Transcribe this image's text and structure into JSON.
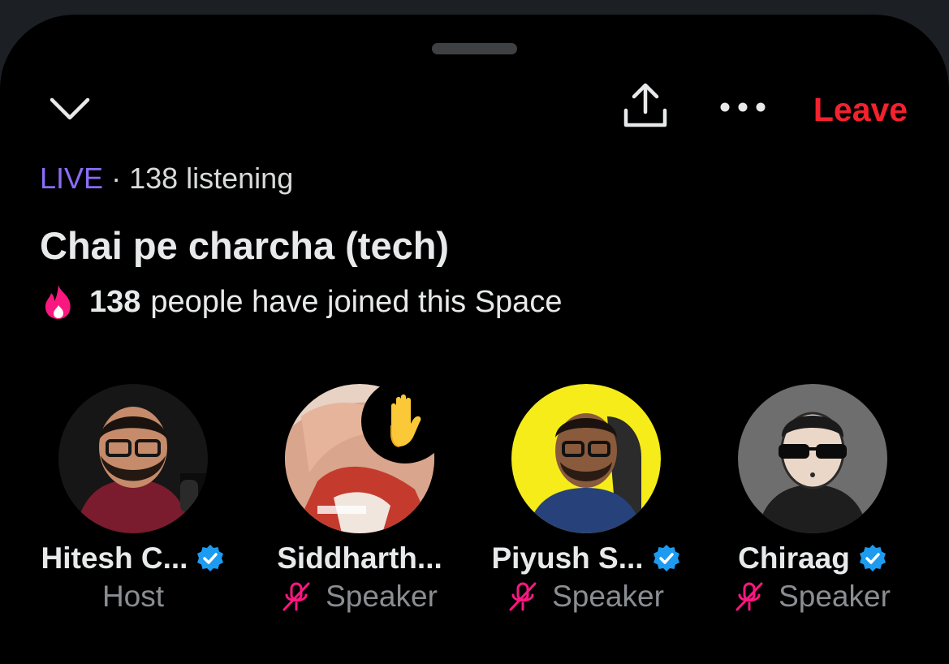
{
  "header": {
    "collapse_icon": "chevron-down-icon",
    "share_icon": "share-upload-icon",
    "more_icon": "more-dots-icon",
    "leave_label": "Leave"
  },
  "space": {
    "live_label": "LIVE",
    "separator": "·",
    "listening": "138 listening",
    "title": "Chai pe charcha (tech)",
    "joined_icon": "flame-icon",
    "joined_count": "138",
    "joined_text": "people have joined this Space"
  },
  "participants": [
    {
      "name": "Hitesh C...",
      "verified": true,
      "role": "Host",
      "muted": false,
      "hand_raised": false
    },
    {
      "name": "Siddharth...",
      "verified": false,
      "role": "Speaker",
      "muted": true,
      "hand_raised": true,
      "hand_icon": "raised-hand-icon"
    },
    {
      "name": "Piyush S...",
      "verified": true,
      "role": "Speaker",
      "muted": true,
      "hand_raised": false
    },
    {
      "name": "Chiraag",
      "verified": true,
      "role": "Speaker",
      "muted": true,
      "hand_raised": false
    }
  ],
  "colors": {
    "accent_live": "#8b6cf6",
    "leave": "#f4212e",
    "verified": "#1d9bf0",
    "muted_mic": "#f91880",
    "flame": "#f91880",
    "background": "#000000"
  }
}
